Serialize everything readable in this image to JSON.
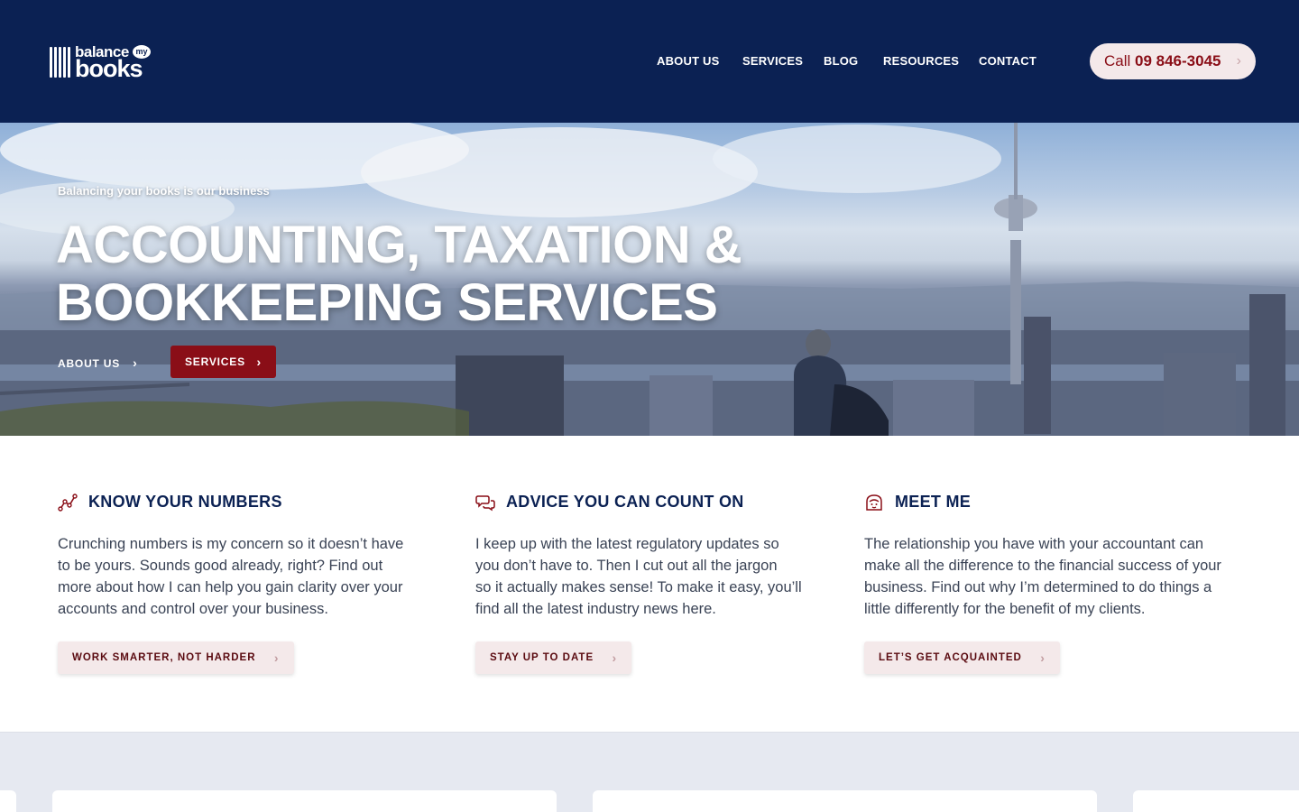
{
  "header": {
    "logo": {
      "line1": "balance",
      "badge": "my",
      "line2": "books"
    },
    "nav": [
      "ABOUT US",
      "SERVICES",
      "BLOG",
      "RESOURCES",
      "CONTACT"
    ],
    "call": {
      "prefix": "Call ",
      "number": "09 846-3045",
      "icon": "chevron-right-icon"
    }
  },
  "hero": {
    "tagline": "Balancing your books is our business",
    "title_line1": "ACCOUNTING, TAXATION &",
    "title_line2": "BOOKKEEPING SERVICES",
    "link_label": "ABOUT US",
    "button_label": "SERVICES"
  },
  "features": [
    {
      "icon": "line-chart-icon",
      "title": "KNOW YOUR NUMBERS",
      "lines": [
        "Crunching numbers is my concern so it doesn’t have",
        "to be yours. Sounds good already, right? Find out",
        "more about how I can help you gain clarity over your",
        "accounts and control over your business."
      ],
      "button": "WORK SMARTER, NOT HARDER"
    },
    {
      "icon": "chat-bubbles-icon",
      "title": "ADVICE YOU CAN COUNT ON",
      "lines": [
        "I keep up with the latest regulatory updates so",
        "you don’t have to. Then I cut out all the jargon",
        "so it actually makes sense! To make it easy, you’ll",
        "find all the latest industry news here."
      ],
      "button": "STAY UP TO DATE"
    },
    {
      "icon": "person-face-icon",
      "title": "MEET ME",
      "lines": [
        "The relationship you have with your accountant can",
        "make all the difference to the financial success of your",
        "business. Find out why I’m determined to do things a",
        "little differently for the benefit of my clients."
      ],
      "button": "LET’S GET ACQUAINTED"
    }
  ],
  "colors": {
    "navy": "#0b2153",
    "brand_red": "#8a0e17",
    "pink_bg": "#f4e9ea",
    "band_bg": "#e6e9f1"
  }
}
